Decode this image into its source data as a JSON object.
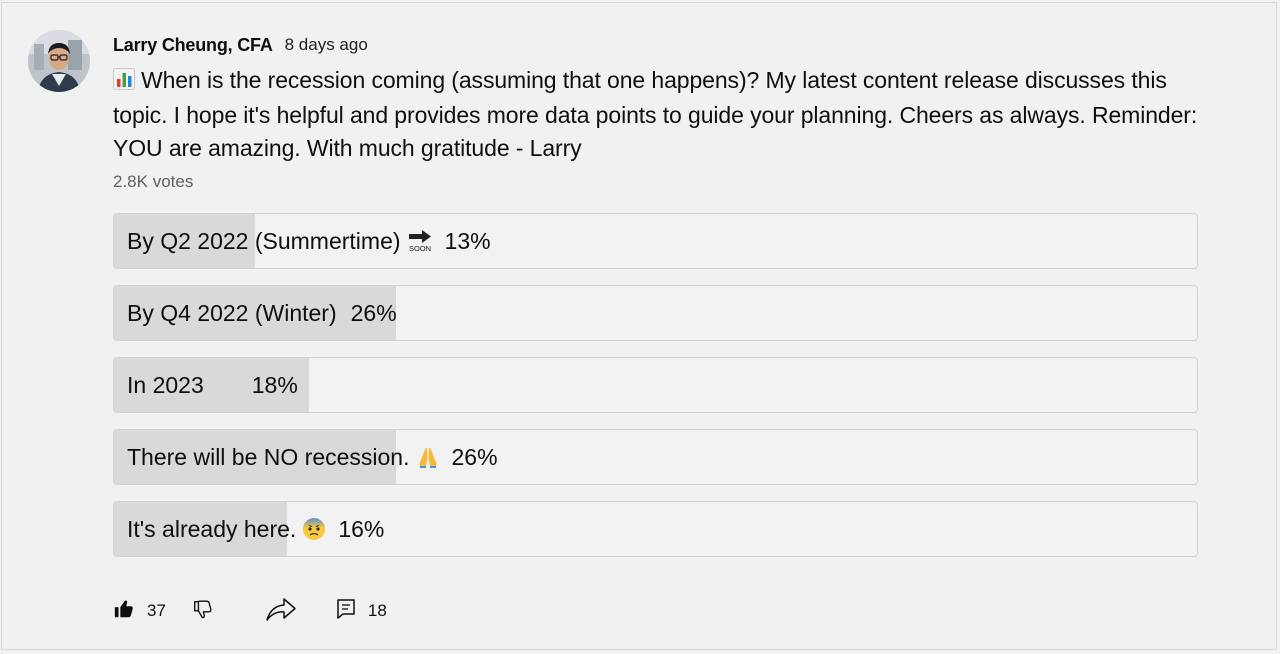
{
  "post": {
    "author": "Larry Cheung, CFA",
    "time": "8 days ago",
    "text": "When is the recession coming (assuming that one happens)? My latest content release discusses this topic. I hope it's helpful and provides more data points to guide your planning. Cheers as always. Reminder: YOU are amazing. With much gratitude - Larry",
    "leading_icon": "bar-chart-emoji"
  },
  "poll": {
    "votes": "2.8K votes",
    "options": [
      {
        "label": "By Q2 2022 (Summertime)",
        "emoji": "soon-arrow-emoji",
        "percent": "13%",
        "fraction": 0.13
      },
      {
        "label": "By Q4 2022 (Winter)",
        "emoji": "",
        "percent": "26%",
        "fraction": 0.26
      },
      {
        "label": "In 2023",
        "emoji": "",
        "percent": "18%",
        "fraction": 0.18
      },
      {
        "label": "There will be NO recession.",
        "emoji": "folded-hands-emoji",
        "percent": "26%",
        "fraction": 0.26
      },
      {
        "label": "It's already here.",
        "emoji": "anxious-face-emoji",
        "percent": "16%",
        "fraction": 0.16
      }
    ]
  },
  "actions": {
    "likes": "37",
    "comments": "18"
  }
}
